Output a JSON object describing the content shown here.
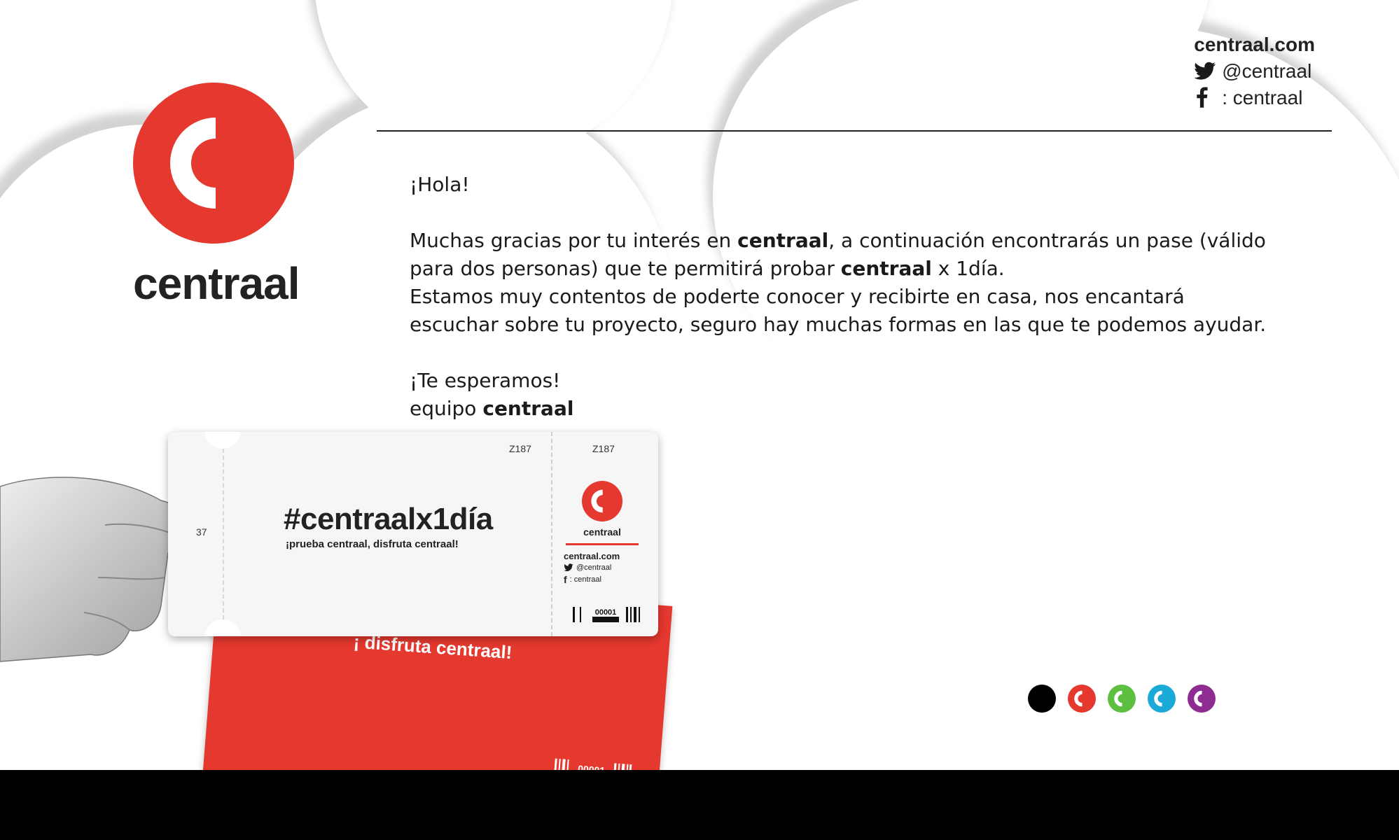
{
  "brand": {
    "name": "centraal",
    "accent_color": "#e5382f",
    "logo_icon": "c-mark-icon"
  },
  "contact": {
    "website": "centraal.com",
    "twitter": "@centraal",
    "facebook": ": centraal",
    "twitter_icon": "twitter-bird-icon",
    "facebook_icon": "facebook-f-icon"
  },
  "letter": {
    "greeting": "¡Hola!",
    "p1_a": "Muchas gracias por tu interés en ",
    "p1_b": "centraal",
    "p1_c": ", a continuación encontrarás un pase (válido para dos personas) que te permitirá probar ",
    "p1_d": "centraal",
    "p1_e": " x 1día.",
    "p2": "Estamos muy contentos de poderte conocer y recibirte en casa, nos encantará escuchar sobre tu proyecto, seguro hay muchas formas en las que te podemos ayudar.",
    "closing": "¡Te esperamos!",
    "sign_a": "equipo ",
    "sign_b": "centraal"
  },
  "ticket": {
    "serial": "Z187",
    "serial_partial": "37",
    "hashtag": "#centraalx1día",
    "tagline": "¡prueba centraal, disfruta centraal!",
    "stub_name": "centraal",
    "stub_site": "centraal.com",
    "stub_twitter": "@centraal",
    "stub_facebook": ": centraal",
    "barcode_number": "00001",
    "back_message": "¡ disfruta centraal!"
  },
  "color_dots": [
    {
      "name": "black",
      "color": "#000000"
    },
    {
      "name": "red",
      "color": "#e5382f"
    },
    {
      "name": "green",
      "color": "#5cbf3f"
    },
    {
      "name": "blue",
      "color": "#1ba9d8"
    },
    {
      "name": "purple",
      "color": "#8e2c92"
    }
  ]
}
